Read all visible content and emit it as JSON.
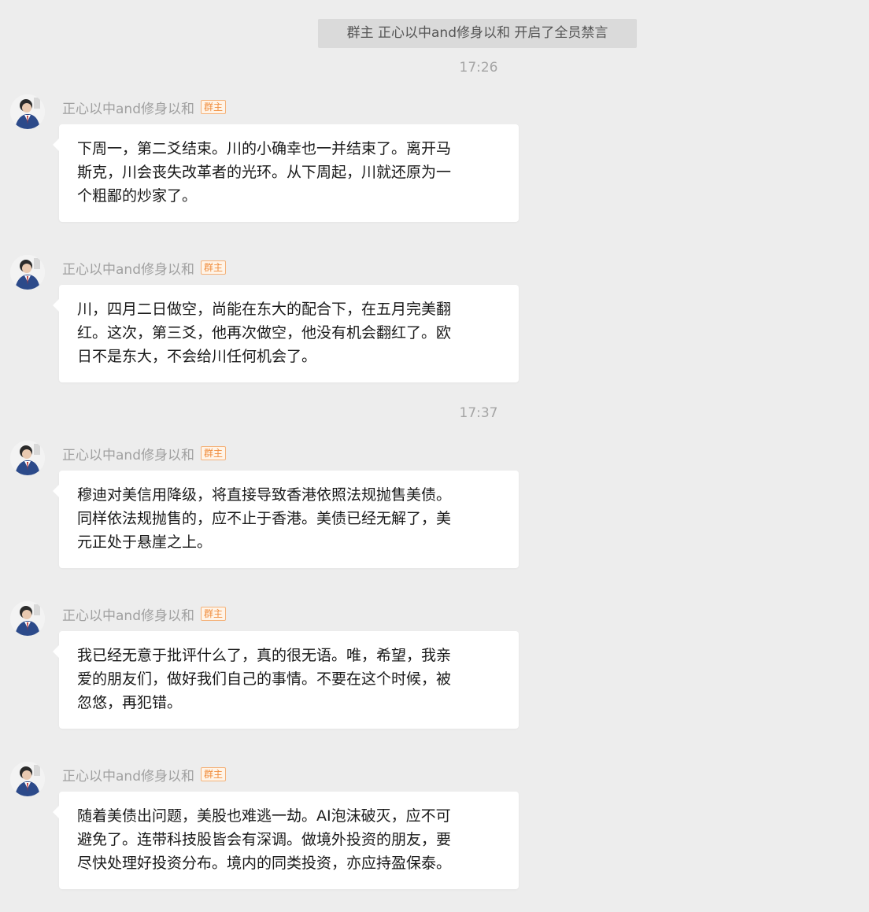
{
  "system_notice": "群主 正心以中and修身以和 开启了全员禁言",
  "timestamps": [
    "17:26",
    "17:37"
  ],
  "sender": {
    "name": "正心以中and修身以和",
    "badge": "群主"
  },
  "messages": [
    {
      "lines": [
        "下周一，第二爻结束。川的小确幸也一并结束了。离开马",
        "斯克，川会丧失改革者的光环。从下周起，川就还原为一",
        "个粗鄙的炒家了。"
      ]
    },
    {
      "lines": [
        "川，四月二日做空，尚能在东大的配合下，在五月完美翻",
        "红。这次，第三爻，他再次做空，他没有机会翻红了。欧",
        "日不是东大，不会给川任何机会了。"
      ]
    },
    {
      "lines": [
        "穆迪对美信用降级，将直接导致香港依照法规抛售美债。",
        "同样依法规抛售的，应不止于香港。美债已经无解了，美",
        "元正处于悬崖之上。"
      ]
    },
    {
      "lines": [
        "我已经无意于批评什么了，真的很无语。唯，希望，我亲",
        "爱的朋友们，做好我们自己的事情。不要在这个时候，被",
        "忽悠，再犯错。"
      ]
    },
    {
      "lines": [
        "随着美债出问题，美股也难逃一劫。AI泡沫破灭，应不可",
        "避免了。连带科技股皆会有深调。做境外投资的朋友，要",
        "尽快处理好投资分布。境内的同类投资，亦应持盈保泰。"
      ]
    }
  ],
  "colors": {
    "background": "#ededed",
    "bubble": "#ffffff",
    "badge": "#f08c3c"
  },
  "icons": {
    "avatar": "avatar-icon"
  }
}
